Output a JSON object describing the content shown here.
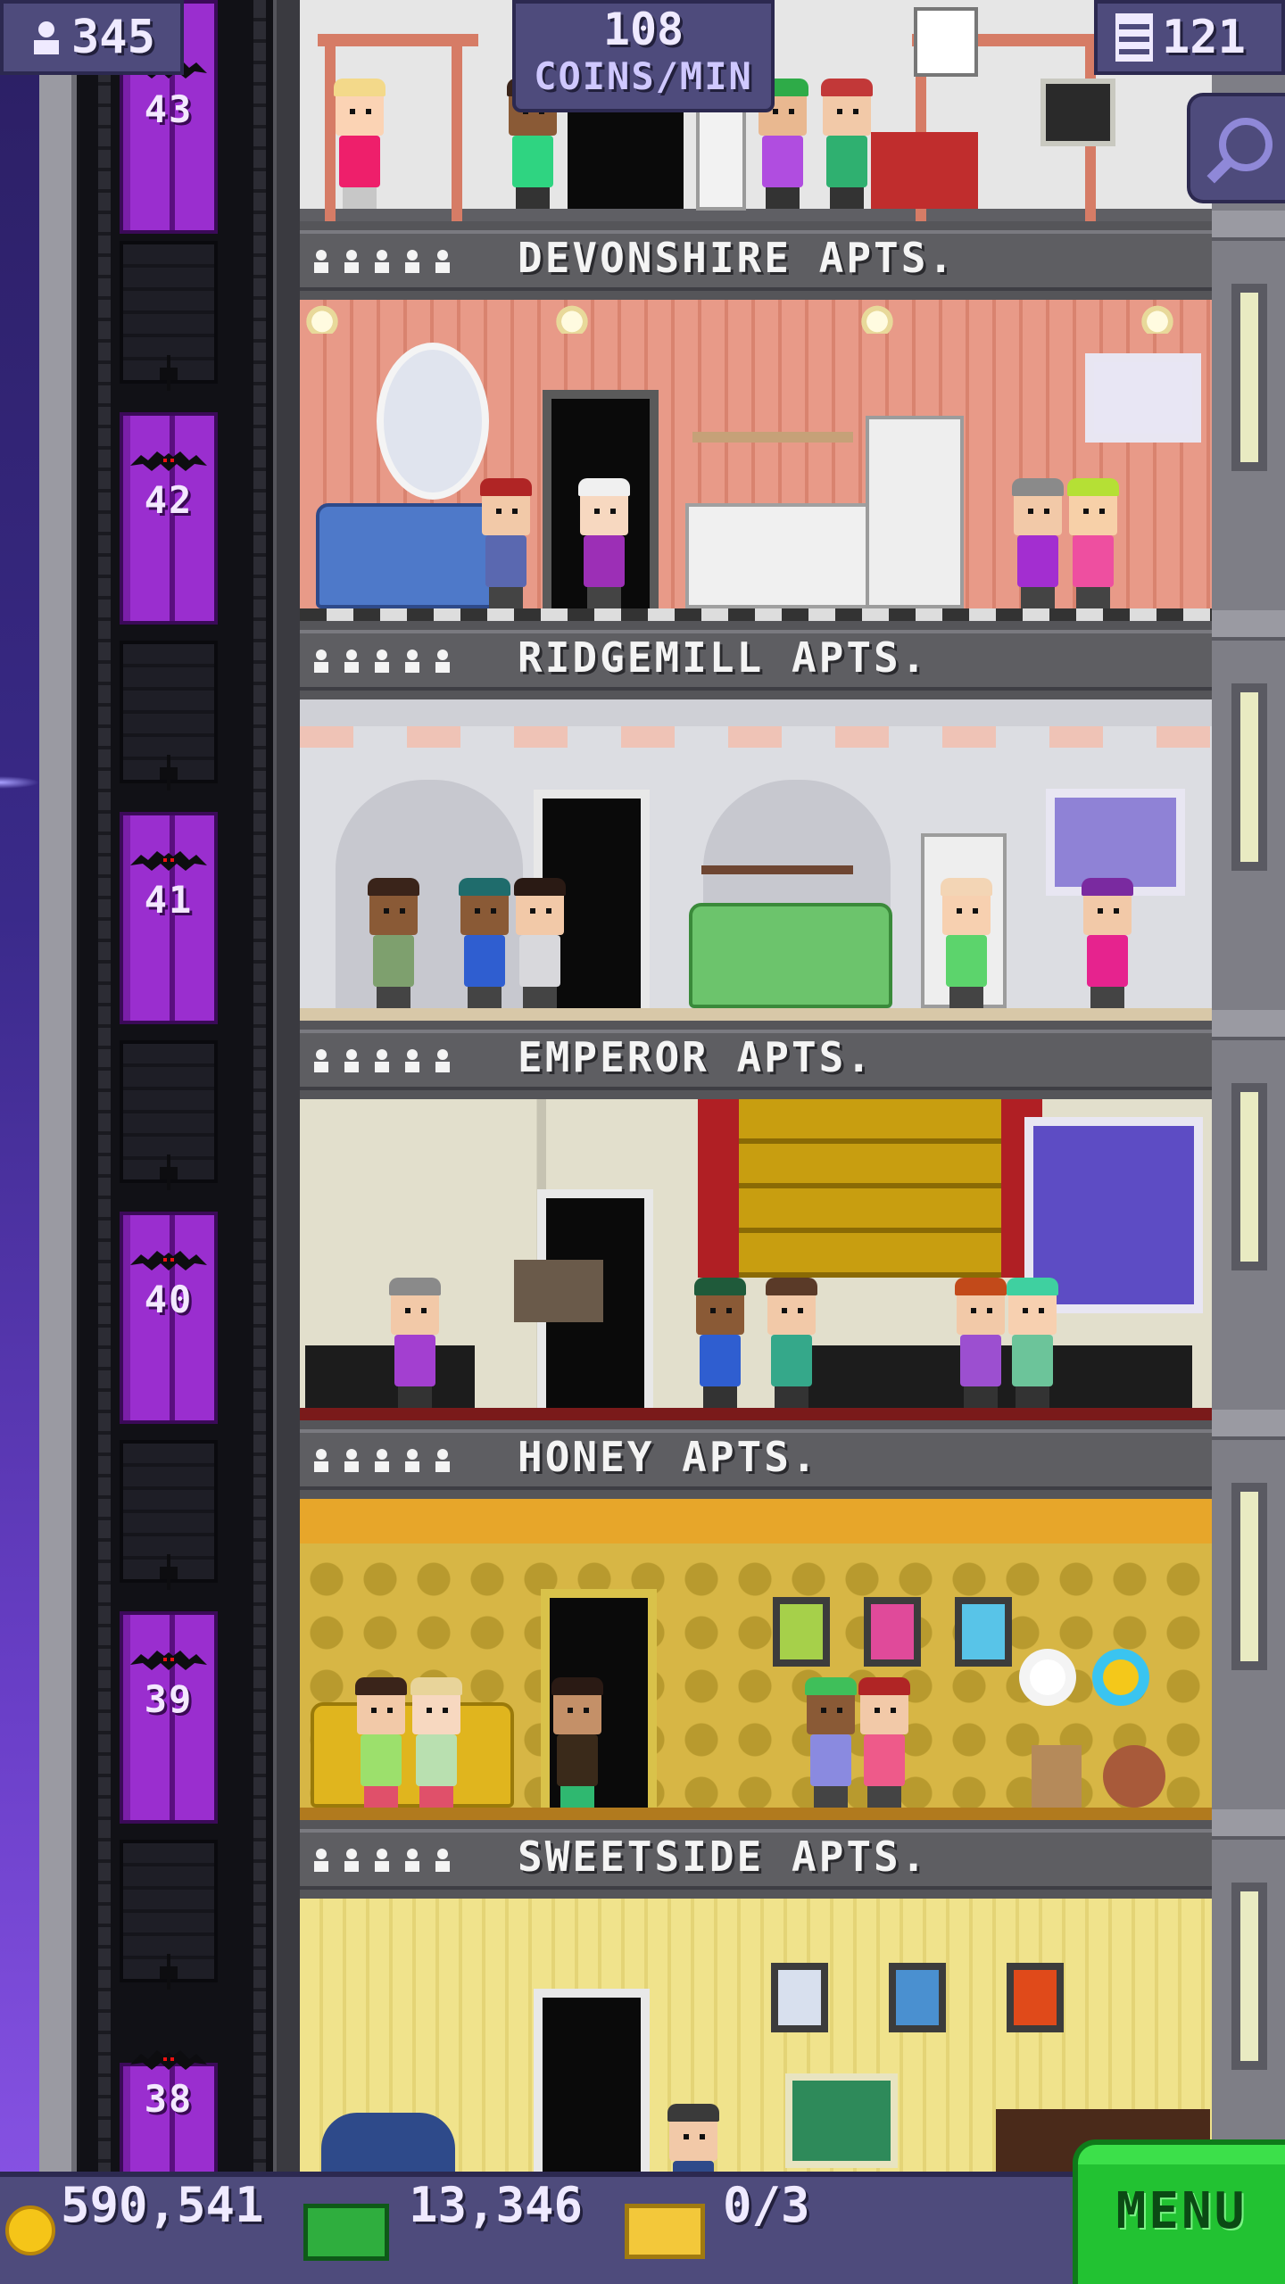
{
  "hud": {
    "population": "345",
    "coins_per_min_value": "108",
    "coins_per_min_unit": "COINS/MIN",
    "floor_count": "121"
  },
  "floors": [
    {
      "number": "43",
      "name": "DEVONSHIRE APTS."
    },
    {
      "number": "42",
      "name": "RIDGEMILL APTS."
    },
    {
      "number": "41",
      "name": "EMPEROR APTS."
    },
    {
      "number": "40",
      "name": "HONEY APTS."
    },
    {
      "number": "39",
      "name": "SWEETSIDE APTS."
    },
    {
      "number": "38",
      "name": ""
    }
  ],
  "bottom": {
    "coins": "590,541",
    "tower_bux": "13,346",
    "tickets": "0/3",
    "menu_label": "MENU"
  },
  "colors": {
    "accent_purple": "#9a2ecf",
    "hud_bg": "#4e4b7c",
    "menu_green": "#22c232",
    "coin_gold": "#f5c518"
  },
  "icons": [
    "population-icon",
    "floors-icon",
    "search-icon",
    "coin-icon",
    "bux-icon",
    "ticket-icon",
    "bat-icon",
    "resident-icon"
  ]
}
